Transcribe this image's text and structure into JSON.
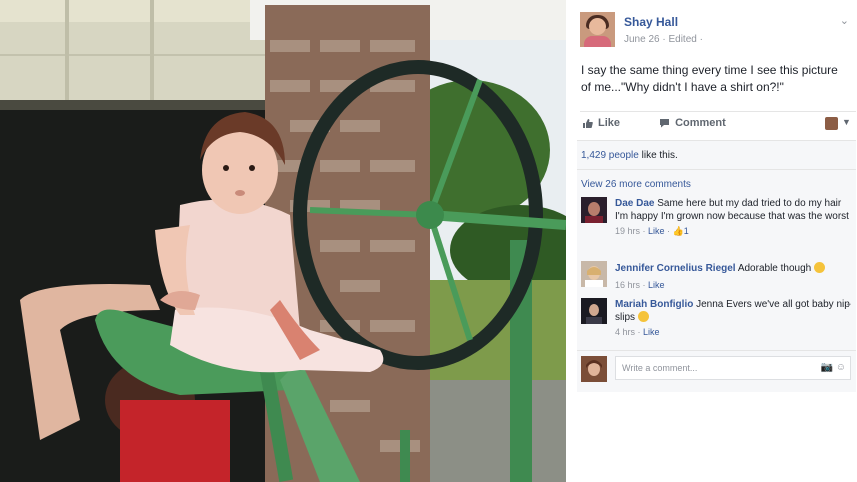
{
  "post": {
    "author": "Shay Hall",
    "meta": "June 26 · Edited ·",
    "text": "I say the same thing every time I see this picture of me...\"Why didn't I have a shirt on?!\"",
    "like_label": "Like",
    "comment_label": "Comment"
  },
  "stats": {
    "likes_count": "1,429 people",
    "likes_suffix": " like this.",
    "view_more": "View 26 more comments"
  },
  "comments": [
    {
      "name": "Dae Dae",
      "text": "Same here but my dad tried to do my hair I'm happy I'm grown now because that was the worst",
      "time": "19 hrs",
      "like": "Like",
      "reactions": "1"
    },
    {
      "name": "Jennifer Cornelius Riegel",
      "text": "Adorable though",
      "time": "16 hrs",
      "like": "Like"
    },
    {
      "name": "Mariah Bonfiglio",
      "text": "Jenna Evers we've all got baby nip slips",
      "time": "4 hrs",
      "like": "Like"
    }
  ],
  "composer": {
    "placeholder": "Write a comment..."
  }
}
